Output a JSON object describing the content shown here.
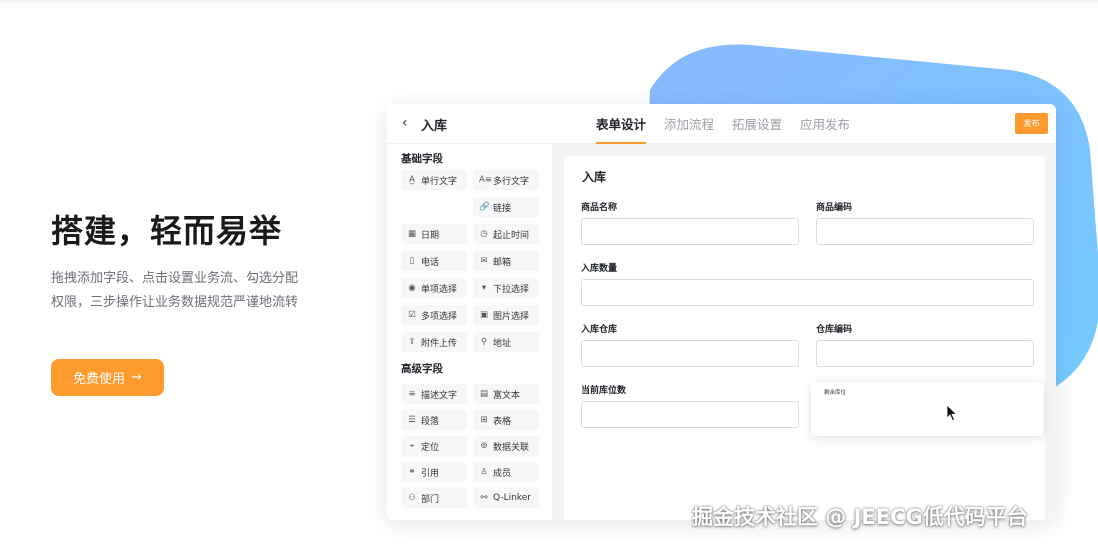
{
  "hero": {
    "title": "搭建，轻而易举",
    "desc": "拖拽添加字段、点击设置业务流、勾选分配权限，三步操作让业务数据规范严谨地流转",
    "cta_label": "免费使用",
    "cta_arrow": "→"
  },
  "window": {
    "back_icon": "‹",
    "title": "入库",
    "tabs": [
      "表单设计",
      "添加流程",
      "拓展设置",
      "应用发布"
    ],
    "active_tab": "表单设计",
    "publish_label": "发布"
  },
  "palette": {
    "basic_title": "基础字段",
    "basic_fields": [
      {
        "label": "单行文字",
        "icon": "A̲"
      },
      {
        "label": "多行文字",
        "icon": "A≡"
      },
      {
        "label": "链接",
        "icon": "🔗"
      },
      {
        "label": "日期",
        "icon": "▦"
      },
      {
        "label": "起止时间",
        "icon": "◷"
      },
      {
        "label": "电话",
        "icon": "▯"
      },
      {
        "label": "邮箱",
        "icon": "✉"
      },
      {
        "label": "单项选择",
        "icon": "◉"
      },
      {
        "label": "下拉选择",
        "icon": "▾"
      },
      {
        "label": "多项选择",
        "icon": "☑"
      },
      {
        "label": "图片选择",
        "icon": "▣"
      },
      {
        "label": "附件上传",
        "icon": "⇪"
      },
      {
        "label": "地址",
        "icon": "⚲"
      }
    ],
    "advanced_title": "高级字段",
    "advanced_fields": [
      {
        "label": "描述文字",
        "icon": "≡"
      },
      {
        "label": "富文本",
        "icon": "▤"
      },
      {
        "label": "段落",
        "icon": "☰"
      },
      {
        "label": "表格",
        "icon": "⊞"
      },
      {
        "label": "定位",
        "icon": "⌖"
      },
      {
        "label": "数据关联",
        "icon": "⊚"
      },
      {
        "label": "引用",
        "icon": "⚭"
      },
      {
        "label": "成员",
        "icon": "♙"
      },
      {
        "label": "部门",
        "icon": "⚇"
      },
      {
        "label": "Q-Linker",
        "icon": "⚯"
      }
    ]
  },
  "form": {
    "title": "入库",
    "fields": {
      "product_name": "商品名称",
      "product_code": "商品编码",
      "quantity": "入库数量",
      "warehouse": "入库仓库",
      "warehouse_code": "仓库编码",
      "bin": "当前库位数"
    },
    "dragging_label": "剩余库位"
  },
  "watermark": "掘金技术社区 @ JEECG低代码平台",
  "colors": {
    "accent": "#ff9a2e",
    "blob_top": "#6aa8ff",
    "blob_bottom": "#7fd0ff"
  }
}
